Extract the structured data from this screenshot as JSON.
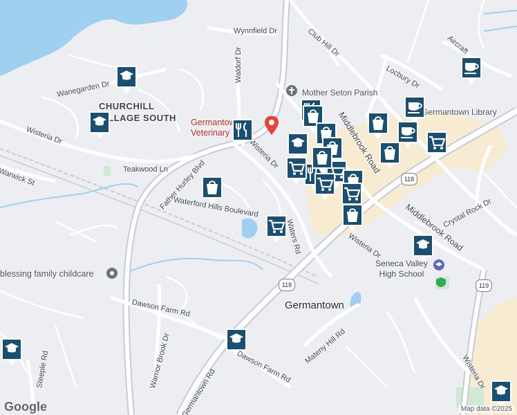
{
  "map": {
    "town": "Germantown",
    "area": "CHURCHILL\nVILLAGE SOUTH",
    "roads": [
      "Wynnfield Dr",
      "Club Hill Dr",
      "Wanegarden Dr",
      "Waldorf Dr",
      "Locbury Dr",
      "Aircraft",
      "Wisteria Dr",
      "Teakwood Ln",
      "Father Hurley Blvd",
      "Warwick St",
      "Waterford Hills Boulevard",
      "Middlebrook Road",
      "Crystal Rock Dr",
      "Waters Rd",
      "Dawson Farm Rd",
      "Warrior Brook Dr",
      "Mateny Hill Rd",
      "Steeple Rd",
      "Germantown Rd",
      "Wisteria Dr"
    ],
    "places": {
      "parish": "Mother Seton Parish",
      "library": "Germantown Library",
      "vet": "Germantown Veterinary",
      "childcare": "blessing family childcare",
      "school": "Seneca Valley\nHigh School"
    },
    "route_shields": [
      "118",
      "118",
      "119"
    ],
    "footer": {
      "logo": "Google",
      "credit": "Map data ©2025"
    },
    "colors": {
      "water": "#9fd0ef",
      "road": "#ffffff",
      "highway": "#c6ccd6",
      "marker": "#1a4f74",
      "commercial": "#f7ecd2",
      "park": "#cfe9d5"
    }
  }
}
